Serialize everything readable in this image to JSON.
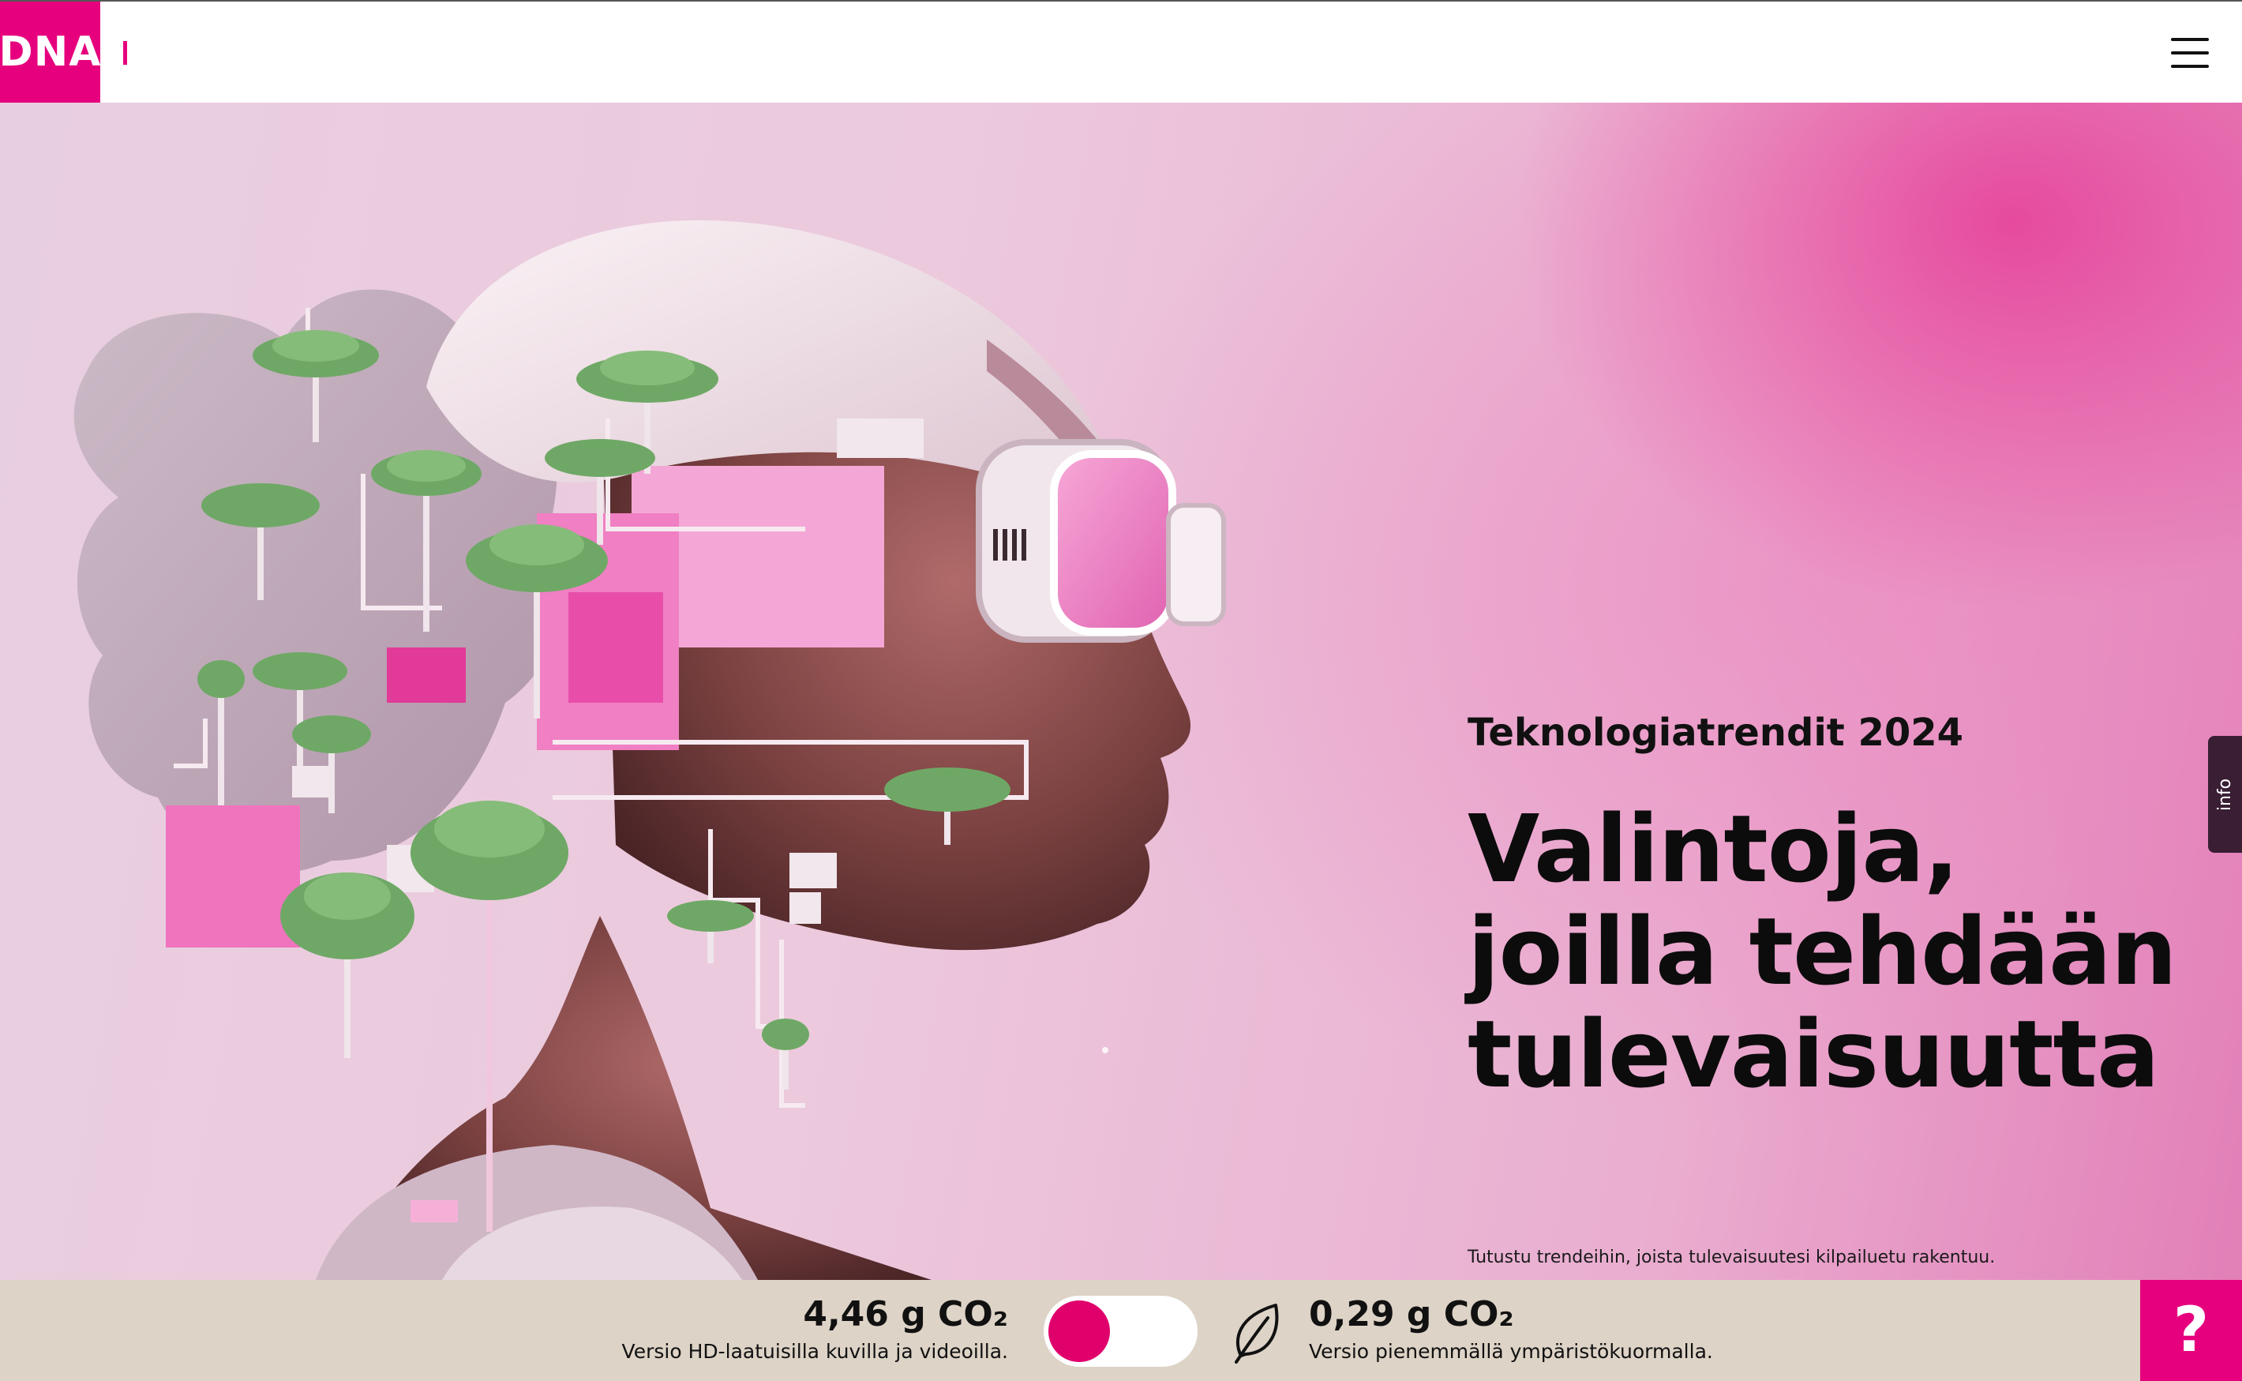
{
  "brand": {
    "logo_text": "DNA",
    "color": "#e6007e"
  },
  "header": {
    "menu_icon": "hamburger-menu-icon"
  },
  "hero": {
    "eyebrow": "Teknologiatrendit 2024",
    "headline": [
      "Valintoja,",
      "joilla tehdään",
      "tulevaisuutta"
    ],
    "subtitle": "Tutustu trendeihin, joista tulevaisuutesi kilpailuetu rakentuu.",
    "info_tab": "info"
  },
  "footer": {
    "hd_version": {
      "value": "4,46 g CO₂",
      "label": "Versio HD-laatuisilla kuvilla ja videoilla."
    },
    "eco_version": {
      "value": "0,29 g CO₂",
      "label": "Versio pienemmällä ympäristökuormalla.",
      "icon": "leaf-icon"
    },
    "toggle_state": "hd",
    "help_label": "?"
  }
}
